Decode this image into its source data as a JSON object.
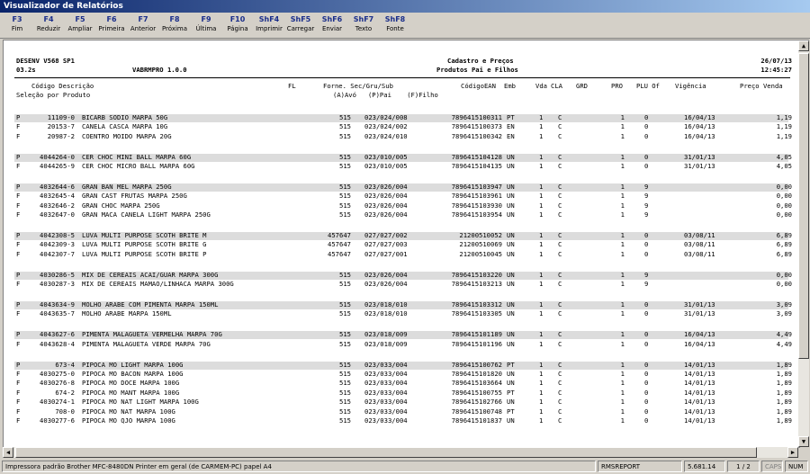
{
  "window": {
    "title": "Visualizador de Relatórios"
  },
  "toolbar": [
    {
      "key": "F3",
      "label": "Fim"
    },
    {
      "key": "F4",
      "label": "Reduzir"
    },
    {
      "key": "F5",
      "label": "Ampliar"
    },
    {
      "key": "F6",
      "label": "Primeira"
    },
    {
      "key": "F7",
      "label": "Anterior"
    },
    {
      "key": "F8",
      "label": "Próxima"
    },
    {
      "key": "F9",
      "label": "Última"
    },
    {
      "key": "F10",
      "label": "Página"
    },
    {
      "key": "ShF4",
      "label": "Imprimir"
    },
    {
      "key": "ShF5",
      "label": "Carregar"
    },
    {
      "key": "ShF6",
      "label": "Enviar"
    },
    {
      "key": "ShF7",
      "label": "Texto"
    },
    {
      "key": "ShF8",
      "label": "Fonte"
    }
  ],
  "report": {
    "header": {
      "left1": "DESENV V568 SP1",
      "left2": "03.2s",
      "program": "VABRMPRO 1.0.0",
      "title1": "Cadastro e Preços",
      "title2": "Produtos Pai e Filhos",
      "date": "26/07/13",
      "time": "12:45:27"
    },
    "columns": {
      "codigo_descricao": "Código Descrição",
      "fl": "FL",
      "forne_sec": "Forne. Sec/Gru/Sub",
      "codigo_ean": "CódigoEAN",
      "emb": "Emb",
      "vda": "Vda",
      "cla": "CLA",
      "grd": "GRD",
      "pro": "PRO",
      "plu_of": "PLU Of",
      "vigencia": "Vigência",
      "preco_venda": "Preço Venda"
    },
    "selection": "Seleção por Produto",
    "legend": "(A)Avó   (P)Pai    (F)Filho",
    "groups": [
      {
        "rows": [
          {
            "t": "P",
            "code": "11109-0",
            "desc": "BICARB SODIO MARPA 50G",
            "forn": "515",
            "sec": "023/024/008",
            "ean": "7896415100311",
            "emb": "PT",
            "vda": "1",
            "cla": "C",
            "pro": "1",
            "plu": "0",
            "vig": "16/04/13",
            "preco": "1,19"
          },
          {
            "t": "F",
            "code": "20153-7",
            "desc": "CANELA CASCA MARPA 10G",
            "forn": "515",
            "sec": "023/024/002",
            "ean": "7896415100373",
            "emb": "EN",
            "vda": "1",
            "cla": "C",
            "pro": "1",
            "plu": "0",
            "vig": "16/04/13",
            "preco": "1,19"
          },
          {
            "t": "F",
            "code": "20987-2",
            "desc": "COENTRO MOIDO MARPA 20G",
            "forn": "515",
            "sec": "023/024/010",
            "ean": "7896415100342",
            "emb": "EN",
            "vda": "1",
            "cla": "C",
            "pro": "1",
            "plu": "0",
            "vig": "16/04/13",
            "preco": "1,19"
          }
        ]
      },
      {
        "rows": [
          {
            "t": "P",
            "code": "4044264-0",
            "desc": "CER CHOC MINI BALL MARPA 60G",
            "forn": "515",
            "sec": "023/010/005",
            "ean": "7896415104128",
            "emb": "UN",
            "vda": "1",
            "cla": "C",
            "pro": "1",
            "plu": "0",
            "vig": "31/01/13",
            "preco": "4,05"
          },
          {
            "t": "F",
            "code": "4044265-9",
            "desc": "CER CHOC MICRO BALL MARPA 60G",
            "forn": "515",
            "sec": "023/010/005",
            "ean": "7896415104135",
            "emb": "UN",
            "vda": "1",
            "cla": "C",
            "pro": "1",
            "plu": "0",
            "vig": "31/01/13",
            "preco": "4,05"
          }
        ]
      },
      {
        "rows": [
          {
            "t": "P",
            "code": "4032644-6",
            "desc": "GRAN BAN MEL MARPA 250G",
            "forn": "515",
            "sec": "023/026/004",
            "ean": "7896415103947",
            "emb": "UN",
            "vda": "1",
            "cla": "C",
            "pro": "1",
            "plu": "9",
            "vig": "",
            "preco": "0,00"
          },
          {
            "t": "F",
            "code": "4032645-4",
            "desc": "GRAN CAST FRUTAS MARPA 250G",
            "forn": "515",
            "sec": "023/026/004",
            "ean": "7896415103961",
            "emb": "UN",
            "vda": "1",
            "cla": "C",
            "pro": "1",
            "plu": "9",
            "vig": "",
            "preco": "0,00"
          },
          {
            "t": "F",
            "code": "4032646-2",
            "desc": "GRAN CHOC MARPA 250G",
            "forn": "515",
            "sec": "023/026/004",
            "ean": "7896415103930",
            "emb": "UN",
            "vda": "1",
            "cla": "C",
            "pro": "1",
            "plu": "9",
            "vig": "",
            "preco": "0,00"
          },
          {
            "t": "F",
            "code": "4032647-0",
            "desc": "GRAN MACA CANELA LIGHT MARPA 250G",
            "forn": "515",
            "sec": "023/026/004",
            "ean": "7896415103954",
            "emb": "UN",
            "vda": "1",
            "cla": "C",
            "pro": "1",
            "plu": "9",
            "vig": "",
            "preco": "0,00"
          }
        ]
      },
      {
        "rows": [
          {
            "t": "P",
            "code": "4042308-5",
            "desc": "LUVA MULTI PURPOSE SCOTH BRITE M",
            "forn": "457647",
            "sec": "027/027/002",
            "ean": "21200510052",
            "emb": "UN",
            "vda": "1",
            "cla": "C",
            "pro": "1",
            "plu": "0",
            "vig": "03/08/11",
            "preco": "6,89"
          },
          {
            "t": "F",
            "code": "4042309-3",
            "desc": "LUVA MULTI PURPOSE SCOTH BRITE G",
            "forn": "457647",
            "sec": "027/027/003",
            "ean": "21200510069",
            "emb": "UN",
            "vda": "1",
            "cla": "C",
            "pro": "1",
            "plu": "0",
            "vig": "03/08/11",
            "preco": "6,89"
          },
          {
            "t": "F",
            "code": "4042307-7",
            "desc": "LUVA MULTI PURPOSE SCOTH BRITE P",
            "forn": "457647",
            "sec": "027/027/001",
            "ean": "21200510045",
            "emb": "UN",
            "vda": "1",
            "cla": "C",
            "pro": "1",
            "plu": "0",
            "vig": "03/08/11",
            "preco": "6,89"
          }
        ]
      },
      {
        "rows": [
          {
            "t": "P",
            "code": "4030286-5",
            "desc": "MIX DE CEREAIS ACAI/GUAR MARPA 300G",
            "forn": "515",
            "sec": "023/026/004",
            "ean": "7896415103220",
            "emb": "UN",
            "vda": "1",
            "cla": "C",
            "pro": "1",
            "plu": "9",
            "vig": "",
            "preco": "0,00"
          },
          {
            "t": "F",
            "code": "4030287-3",
            "desc": "MIX DE CEREAIS MAMAO/LINHACA MARPA 300G",
            "forn": "515",
            "sec": "023/026/004",
            "ean": "7896415103213",
            "emb": "UN",
            "vda": "1",
            "cla": "C",
            "pro": "1",
            "plu": "9",
            "vig": "",
            "preco": "0,00"
          }
        ]
      },
      {
        "rows": [
          {
            "t": "P",
            "code": "4043634-9",
            "desc": "MOLHO ARABE COM PIMENTA MARPA 150ML",
            "forn": "515",
            "sec": "023/018/010",
            "ean": "7896415103312",
            "emb": "UN",
            "vda": "1",
            "cla": "C",
            "pro": "1",
            "plu": "0",
            "vig": "31/01/13",
            "preco": "3,09"
          },
          {
            "t": "F",
            "code": "4043635-7",
            "desc": "MOLHO ARABE MARPA 150ML",
            "forn": "515",
            "sec": "023/018/010",
            "ean": "7896415103305",
            "emb": "UN",
            "vda": "1",
            "cla": "C",
            "pro": "1",
            "plu": "0",
            "vig": "31/01/13",
            "preco": "3,09"
          }
        ]
      },
      {
        "rows": [
          {
            "t": "P",
            "code": "4043627-6",
            "desc": "PIMENTA MALAGUETA VERMELHA MARPA 70G",
            "forn": "515",
            "sec": "023/018/009",
            "ean": "7896415101189",
            "emb": "UN",
            "vda": "1",
            "cla": "C",
            "pro": "1",
            "plu": "0",
            "vig": "16/04/13",
            "preco": "4,49"
          },
          {
            "t": "F",
            "code": "4043628-4",
            "desc": "PIMENTA MALAGUETA VERDE MARPA 70G",
            "forn": "515",
            "sec": "023/018/009",
            "ean": "7896415101196",
            "emb": "UN",
            "vda": "1",
            "cla": "C",
            "pro": "1",
            "plu": "0",
            "vig": "16/04/13",
            "preco": "4,49"
          }
        ]
      },
      {
        "rows": [
          {
            "t": "P",
            "code": "673-4",
            "desc": "PIPOCA MO LIGHT MARPA 100G",
            "forn": "515",
            "sec": "023/033/004",
            "ean": "7896415100762",
            "emb": "PT",
            "vda": "1",
            "cla": "C",
            "pro": "1",
            "plu": "0",
            "vig": "14/01/13",
            "preco": "1,89"
          },
          {
            "t": "F",
            "code": "4030275-0",
            "desc": "PIPOCA MO BACON MARPA 100G",
            "forn": "515",
            "sec": "023/033/004",
            "ean": "7896415101820",
            "emb": "UN",
            "vda": "1",
            "cla": "C",
            "pro": "1",
            "plu": "0",
            "vig": "14/01/13",
            "preco": "1,89"
          },
          {
            "t": "F",
            "code": "4030276-8",
            "desc": "PIPOCA MO DOCE MARPA 100G",
            "forn": "515",
            "sec": "023/033/004",
            "ean": "7896415103664",
            "emb": "UN",
            "vda": "1",
            "cla": "C",
            "pro": "1",
            "plu": "0",
            "vig": "14/01/13",
            "preco": "1,89"
          },
          {
            "t": "F",
            "code": "674-2",
            "desc": "PIPOCA MO MANT MARPA 100G",
            "forn": "515",
            "sec": "023/033/004",
            "ean": "7896415100755",
            "emb": "PT",
            "vda": "1",
            "cla": "C",
            "pro": "1",
            "plu": "0",
            "vig": "14/01/13",
            "preco": "1,89"
          },
          {
            "t": "F",
            "code": "4030274-1",
            "desc": "PIPOCA MO NAT LIGHT MARPA 100G",
            "forn": "515",
            "sec": "023/033/004",
            "ean": "7896415102766",
            "emb": "UN",
            "vda": "1",
            "cla": "C",
            "pro": "1",
            "plu": "0",
            "vig": "14/01/13",
            "preco": "1,89"
          },
          {
            "t": "F",
            "code": "708-0",
            "desc": "PIPOCA MO NAT MARPA 100G",
            "forn": "515",
            "sec": "023/033/004",
            "ean": "7896415100748",
            "emb": "PT",
            "vda": "1",
            "cla": "C",
            "pro": "1",
            "plu": "0",
            "vig": "14/01/13",
            "preco": "1,89"
          },
          {
            "t": "F",
            "code": "4030277-6",
            "desc": "PIPOCA MO QJO MARPA 100G",
            "forn": "515",
            "sec": "023/033/004",
            "ean": "7896415101837",
            "emb": "UN",
            "vda": "1",
            "cla": "C",
            "pro": "1",
            "plu": "0",
            "vig": "14/01/13",
            "preco": "1,89"
          }
        ]
      }
    ]
  },
  "status": {
    "printer": "Impressora padrão Brother MFC-8480DN Printer em geral (de CARMEM-PC) papel A4",
    "module": "RMSREPORT",
    "version": "5.681.14",
    "page": "1 / 2",
    "caps": "CAPS",
    "num": "NUM"
  }
}
